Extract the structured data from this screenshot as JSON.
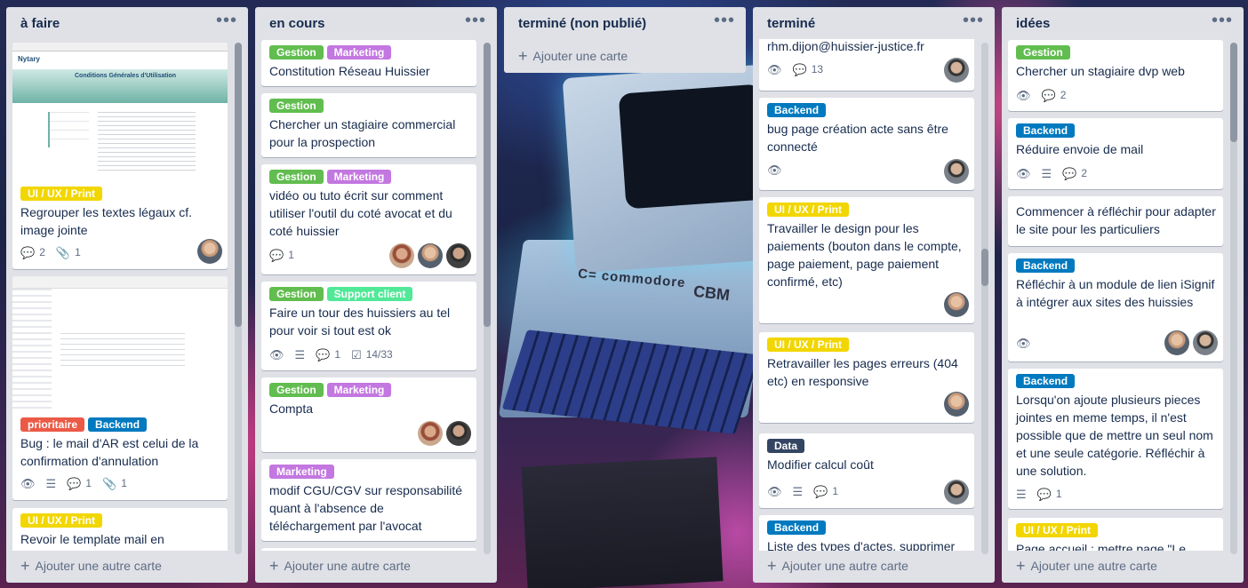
{
  "colors": {
    "green": "#61bd4f",
    "purple": "#c377e0",
    "yellow": "#f2d600",
    "blue": "#0079bf",
    "red": "#eb5a46",
    "aqua": "#51e898",
    "black": "#344563"
  },
  "board": {
    "add_card_label": "Ajouter une carte",
    "add_another_label": "Ajouter une autre carte",
    "lists": [
      {
        "title": "à faire",
        "cards": [
          {
            "labels": [
              {
                "text": "UI / UX / Print"
              }
            ],
            "title": "Regrouper les textes légaux cf. image jointe",
            "comments": "2",
            "attachments": "1",
            "thumb_logo": "Nytary",
            "thumb_banner": "Conditions Générales d'Utilisation"
          },
          {
            "labels": [
              {
                "text": "prioritaire"
              },
              {
                "text": "Backend"
              }
            ],
            "title": "Bug : le mail d'AR est celui de la confirmation d'annulation",
            "comments": "1",
            "attachments": "1"
          },
          {
            "labels": [
              {
                "text": "UI / UX / Print"
              }
            ],
            "title": "Revoir le template mail en"
          }
        ]
      },
      {
        "title": "en cours",
        "cards": [
          {
            "labels": [
              {
                "text": "Gestion"
              },
              {
                "text": "Marketing"
              }
            ],
            "title": "Constitution Réseau Huissier"
          },
          {
            "labels": [
              {
                "text": "Gestion"
              }
            ],
            "title": "Chercher un stagiaire commercial pour la prospection"
          },
          {
            "labels": [
              {
                "text": "Gestion"
              },
              {
                "text": "Marketing"
              }
            ],
            "title": "vidéo ou tuto écrit sur comment utiliser l'outil du coté avocat et du coté huissier",
            "comments": "1"
          },
          {
            "labels": [
              {
                "text": "Gestion"
              },
              {
                "text": "Support client"
              }
            ],
            "title": "Faire un tour des huissiers au tel pour voir si tout est ok",
            "comments": "1",
            "checklist": "14/33"
          },
          {
            "labels": [
              {
                "text": "Gestion"
              },
              {
                "text": "Marketing"
              }
            ],
            "title": "Compta"
          },
          {
            "labels": [
              {
                "text": "Marketing"
              }
            ],
            "title": "modif CGU/CGV sur responsabilité quant à l'absence de téléchargement par l'avocat"
          }
        ]
      },
      {
        "title": "terminé (non publié)",
        "cards": []
      },
      {
        "title": "terminé",
        "cards": [
          {
            "title": "rhm.dijon@huissier-justice.fr",
            "comments": "13"
          },
          {
            "labels": [
              {
                "text": "Backend"
              }
            ],
            "title": "bug page création acte sans être connecté"
          },
          {
            "labels": [
              {
                "text": "UI / UX / Print"
              }
            ],
            "title": "Travailler le design pour les paiements (bouton dans le compte, page paiement, page paiement confirmé, etc)"
          },
          {
            "labels": [
              {
                "text": "UI / UX / Print"
              }
            ],
            "title": "Retravailler les pages erreurs (404 etc) en responsive"
          },
          {
            "labels": [
              {
                "text": "Data"
              }
            ],
            "title": "Modifier calcul coût",
            "comments": "1"
          },
          {
            "labels": [
              {
                "text": "Backend"
              }
            ],
            "title": "Liste des types d'actes, supprimer"
          }
        ]
      },
      {
        "title": "idées",
        "cards": [
          {
            "labels": [
              {
                "text": "Gestion"
              }
            ],
            "title": "Chercher un stagiaire dvp web",
            "comments": "2"
          },
          {
            "labels": [
              {
                "text": "Backend"
              }
            ],
            "title": "Réduire envoie de mail",
            "comments": "2"
          },
          {
            "title": "Commencer à réfléchir pour adapter le site pour les particuliers"
          },
          {
            "labels": [
              {
                "text": "Backend"
              }
            ],
            "title": "Réfléchir à un module de lien iSignif à intégrer aux sites des huissies"
          },
          {
            "labels": [
              {
                "text": "Backend"
              }
            ],
            "title": "Lorsqu'on ajoute plusieurs pieces jointes en meme temps, il n'est possible que de mettre un seul nom et une seule catégorie. Réfléchir à une solution.",
            "comments": "1"
          },
          {
            "labels": [
              {
                "text": "UI / UX / Print"
              }
            ],
            "title": "Page accueil : mettre page \"Le"
          }
        ]
      }
    ]
  },
  "background": {
    "brand_left": "C= commodore",
    "brand_right": "CBM"
  }
}
